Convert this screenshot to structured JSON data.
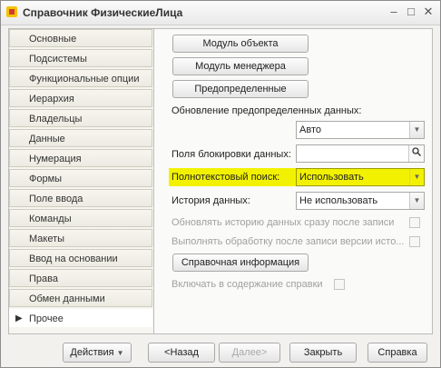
{
  "window": {
    "title": "Справочник ФизическиеЛица"
  },
  "titlebar_buttons": {
    "minimize": "–",
    "maximize": "□",
    "close": "✕"
  },
  "sidebar": {
    "items": [
      {
        "label": "Основные"
      },
      {
        "label": "Подсистемы"
      },
      {
        "label": "Функциональные опции"
      },
      {
        "label": "Иерархия"
      },
      {
        "label": "Владельцы"
      },
      {
        "label": "Данные"
      },
      {
        "label": "Нумерация"
      },
      {
        "label": "Формы"
      },
      {
        "label": "Поле ввода"
      },
      {
        "label": "Команды"
      },
      {
        "label": "Макеты"
      },
      {
        "label": "Ввод на основании"
      },
      {
        "label": "Права"
      },
      {
        "label": "Обмен данными"
      },
      {
        "label": "Прочее"
      }
    ],
    "active_index": 14
  },
  "content": {
    "object_module_button": "Модуль объекта",
    "manager_module_button": "Модуль менеджера",
    "predefined_button": "Предопределенные",
    "update_predefined_label": "Обновление предопределенных данных:",
    "update_predefined_value": "Авто",
    "lock_fields_label": "Поля блокировки данных:",
    "lock_fields_value": "",
    "fulltext_label": "Полнотекстовый поиск:",
    "fulltext_value": "Использовать",
    "history_label": "История данных:",
    "history_value": "Не использовать",
    "update_history_label": "Обновлять историю данных сразу после записи",
    "run_processing_label": "Выполнять обработку после записи версии исто...",
    "help_button": "Справочная информация",
    "include_help_label": "Включать в содержание справки"
  },
  "footer": {
    "actions": "Действия",
    "back": "<Назад",
    "next": "Далее>",
    "close": "Закрыть",
    "help": "Справка"
  },
  "colors": {
    "highlight": "#f2f200"
  }
}
